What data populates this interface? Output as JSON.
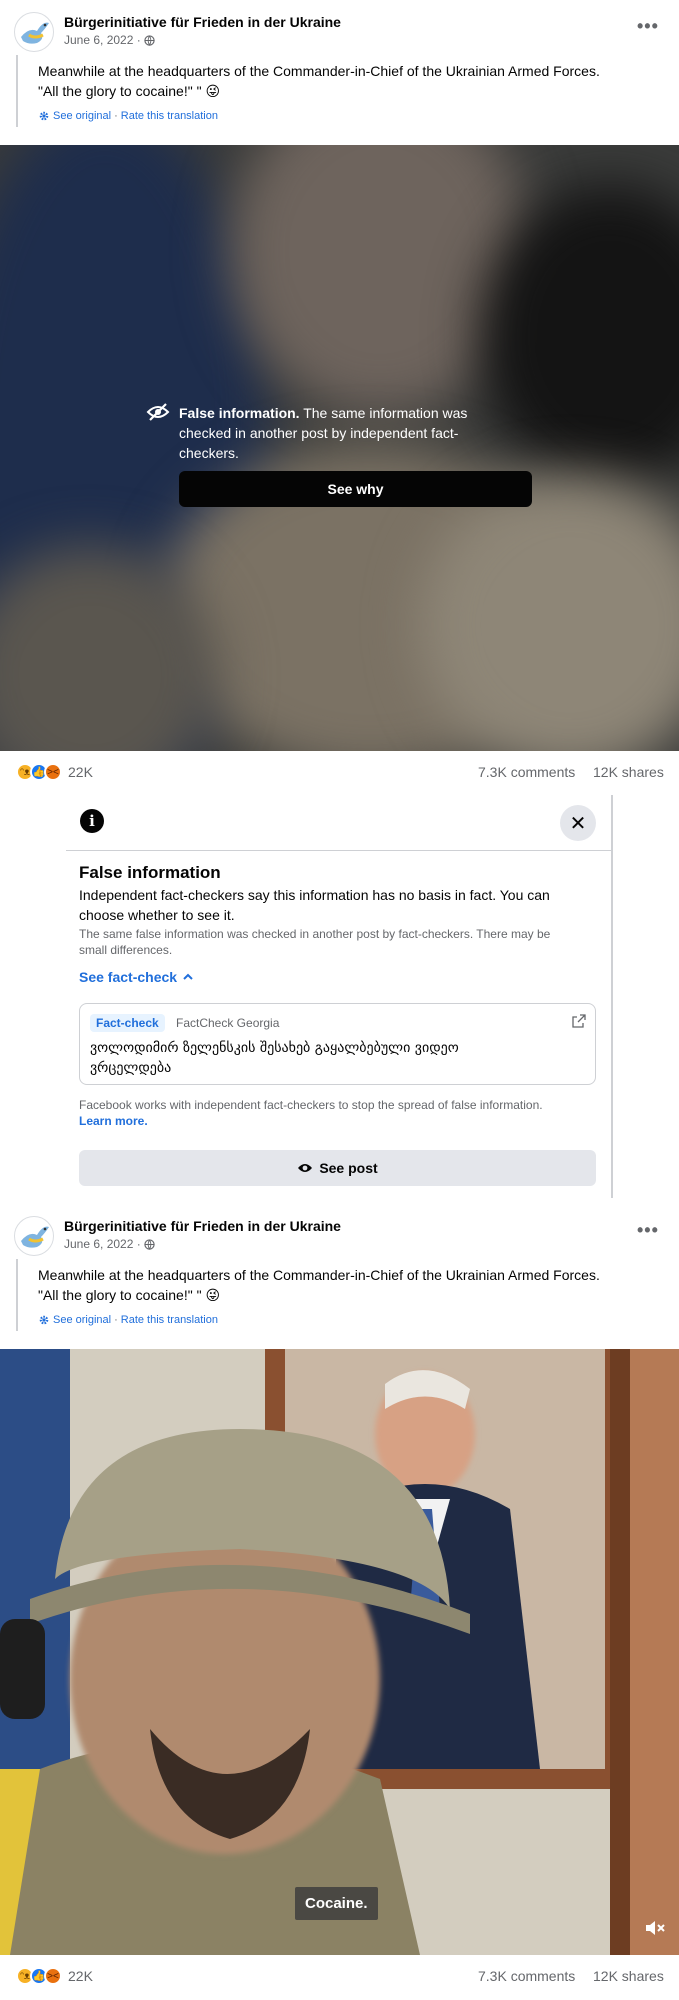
{
  "colors": {
    "link": "#216fdb",
    "secondary_text": "#65676b",
    "button_dark": "#050505",
    "divider": "#ced0d4"
  },
  "post1": {
    "page_name": "Bürgerinitiative für Frieden in der Ukraine",
    "date": "June 6, 2022 ·",
    "privacy_icon": "globe-icon",
    "more_icon": "more-icon",
    "text_line1": "Meanwhile at the headquarters of the Commander-in-Chief of the Ukrainian Armed Forces.",
    "text_line2": "\"All the glory to cocaine!\" \"",
    "emoji": "😜",
    "see_original": "See original",
    "link_sep": "·",
    "rate_translation": "Rate this translation",
    "overlay": {
      "icon": "eye-slash-icon",
      "bold": "False information.",
      "line1": " The same information was",
      "line2": "checked in another post by independent fact-",
      "line3": "checkers.",
      "button": "See why"
    },
    "reaction_count": "22K",
    "comments": "7.3K comments",
    "shares": "12K shares"
  },
  "factcheck_panel": {
    "info_icon": "info-icon",
    "close_icon": "close-icon",
    "title": "False information",
    "body_line1": "Independent fact-checkers say this information has no basis in fact. You can",
    "body_line2": "choose whether to see it.",
    "small_line1": "The same false information was checked in another post by fact-checkers. There may be",
    "small_line2": "small differences.",
    "see_factcheck": "See fact-check",
    "card": {
      "tag": "Fact-check",
      "org": "FactCheck Georgia",
      "title_line1": "ვოლოდიმირ ზელენსკის შესახებ გაყალბებული ვიდეო",
      "title_line2": "ვრცელდება",
      "external_icon": "external-link-icon"
    },
    "footer_line1": "Facebook works with independent fact-checkers to stop the spread of false information.",
    "learn_more": "Learn more.",
    "see_post": "See post",
    "see_post_icon": "eye-icon"
  },
  "post2": {
    "page_name": "Bürgerinitiative für Frieden in der Ukraine",
    "date": "June 6, 2022 ·",
    "text_line1": "Meanwhile at the headquarters of the Commander-in-Chief of the Ukrainian Armed Forces.",
    "text_line2": "\"All the glory to cocaine!\" \"",
    "emoji": "😜",
    "see_original": "See original",
    "link_sep": "·",
    "rate_translation": "Rate this translation",
    "video_caption": "Cocaine.",
    "volume_icon": "volume-muted-icon",
    "reaction_count": "22K",
    "comments": "7.3K comments",
    "shares": "12K shares"
  }
}
